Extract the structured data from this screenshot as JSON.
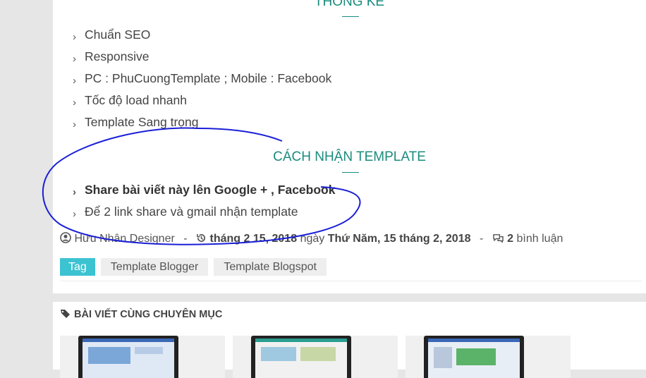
{
  "section1": {
    "heading": "THỐNG KÊ",
    "items": [
      "Chuẩn SEO",
      "Responsive",
      "PC : PhuCuongTemplate ; Mobile : Facebook",
      "Tốc độ load nhanh",
      "Template Sang trọng"
    ]
  },
  "section2": {
    "heading": "CÁCH NHẬN TEMPLATE",
    "items": [
      "Share bài viết này lên Google + , Facebook",
      "Để 2 link share và gmail nhận template"
    ]
  },
  "meta": {
    "author": "Hữu Nhân Designer",
    "date": "tháng 2 15, 2018",
    "ngay": "ngày",
    "weekday_date": "Thứ Năm, 15 tháng 2, 2018",
    "comment_count": "2",
    "comment_label": "bình luận",
    "separator": "-"
  },
  "tags": {
    "label": "Tag",
    "items": [
      "Template Blogger",
      "Template Blogspot"
    ]
  },
  "related": {
    "title": "BÀI VIẾT CÙNG CHUYÊN MỤC"
  },
  "colors": {
    "accent": "#1a8c7d",
    "tag_primary": "#3cc3d1",
    "annotation": "#1a1fd6"
  }
}
